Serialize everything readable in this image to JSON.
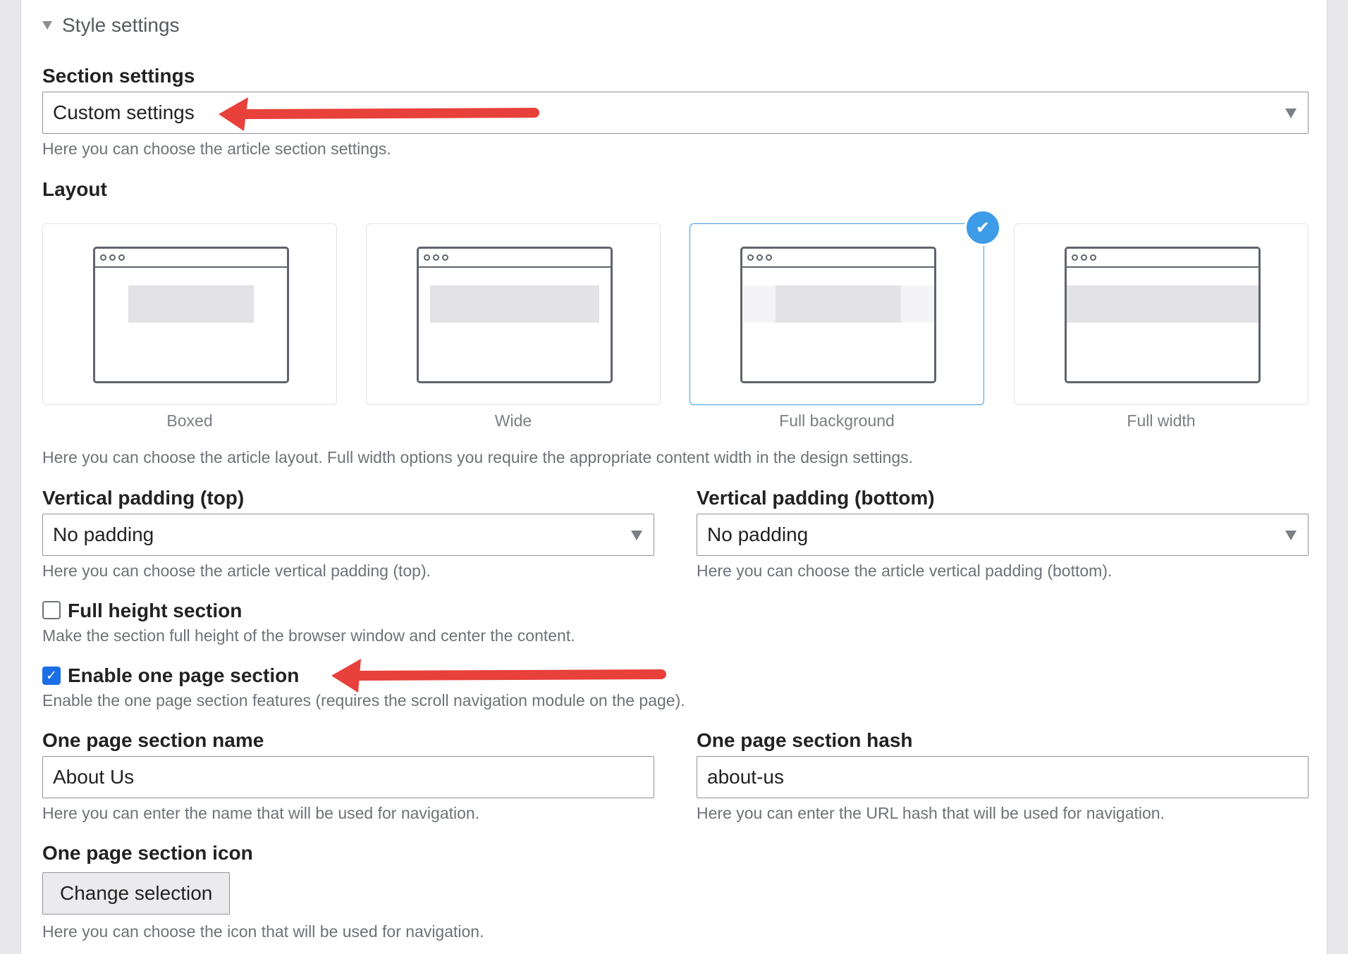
{
  "summary": {
    "label": "Style settings"
  },
  "section_settings": {
    "label": "Section settings",
    "value": "Custom settings",
    "description": "Here you can choose the article section settings."
  },
  "layout": {
    "label": "Layout",
    "options": [
      {
        "label": "Boxed"
      },
      {
        "label": "Wide"
      },
      {
        "label": "Full background"
      },
      {
        "label": "Full width"
      }
    ],
    "selected": "Full background",
    "description": "Here you can choose the article layout. Full width options you require the appropriate content width in the design settings."
  },
  "padding_top": {
    "label": "Vertical padding (top)",
    "value": "No padding",
    "description": "Here you can choose the article vertical padding (top)."
  },
  "padding_bottom": {
    "label": "Vertical padding (bottom)",
    "value": "No padding",
    "description": "Here you can choose the article vertical padding (bottom)."
  },
  "full_height": {
    "label": "Full height section",
    "checked": false,
    "description": "Make the section full height of the browser window and center the content."
  },
  "one_page": {
    "label": "Enable one page section",
    "checked": true,
    "description": "Enable the one page section features (requires the scroll navigation module on the page)."
  },
  "section_name": {
    "label": "One page section name",
    "value": "About Us",
    "description": "Here you can enter the name that will be used for navigation."
  },
  "section_hash": {
    "label": "One page section hash",
    "value": "about-us",
    "description": "Here you can enter the URL hash that will be used for navigation."
  },
  "section_icon": {
    "label": "One page section icon",
    "button": "Change selection",
    "description": "Here you can choose the icon that will be used for navigation."
  },
  "colors": {
    "accent": "#3d9ce8",
    "checkbox": "#1a6ee6",
    "annotation_arrow": "#e8403a"
  }
}
